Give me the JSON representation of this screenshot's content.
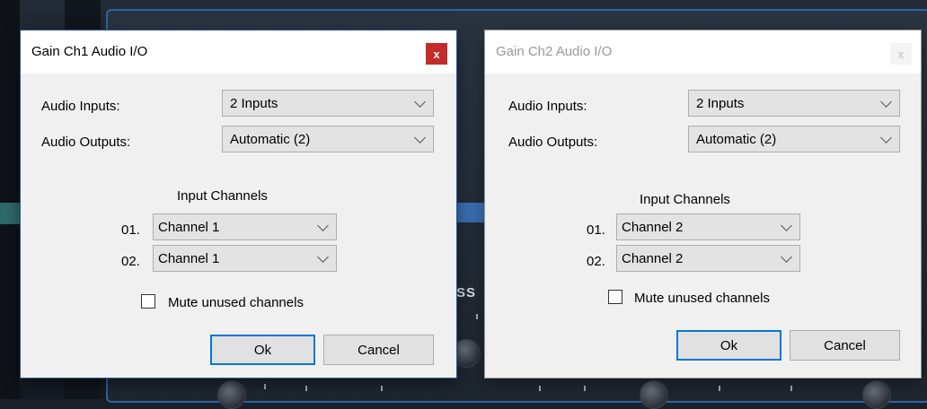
{
  "dialogs": [
    {
      "title": "Gain Ch1 Audio I/O",
      "close_label": "x",
      "audio_inputs_label": "Audio Inputs:",
      "audio_inputs_value": "2 Inputs",
      "audio_outputs_label": "Audio Outputs:",
      "audio_outputs_value": "Automatic (2)",
      "input_channels_title": "Input Channels",
      "channels": [
        {
          "num": "01.",
          "value": "Channel 1"
        },
        {
          "num": "02.",
          "value": "Channel 1"
        }
      ],
      "mute_label": "Mute unused channels",
      "mute_checked": false,
      "ok_label": "Ok",
      "cancel_label": "Cancel",
      "active": true
    },
    {
      "title": "Gain Ch2 Audio I/O",
      "close_label": "x",
      "audio_inputs_label": "Audio Inputs:",
      "audio_inputs_value": "2 Inputs",
      "audio_outputs_label": "Audio Outputs:",
      "audio_outputs_value": "Automatic (2)",
      "input_channels_title": "Input Channels",
      "channels": [
        {
          "num": "01.",
          "value": "Channel 2"
        },
        {
          "num": "02.",
          "value": "Channel 2"
        }
      ],
      "mute_label": "Mute unused channels",
      "mute_checked": false,
      "ok_label": "Ok",
      "cancel_label": "Cancel",
      "active": false
    }
  ],
  "background": {
    "label": "SS"
  },
  "colors": {
    "close_active": "#c42b2b",
    "default_button_border": "#0078d7",
    "plugin_border": "#2d66a8"
  }
}
